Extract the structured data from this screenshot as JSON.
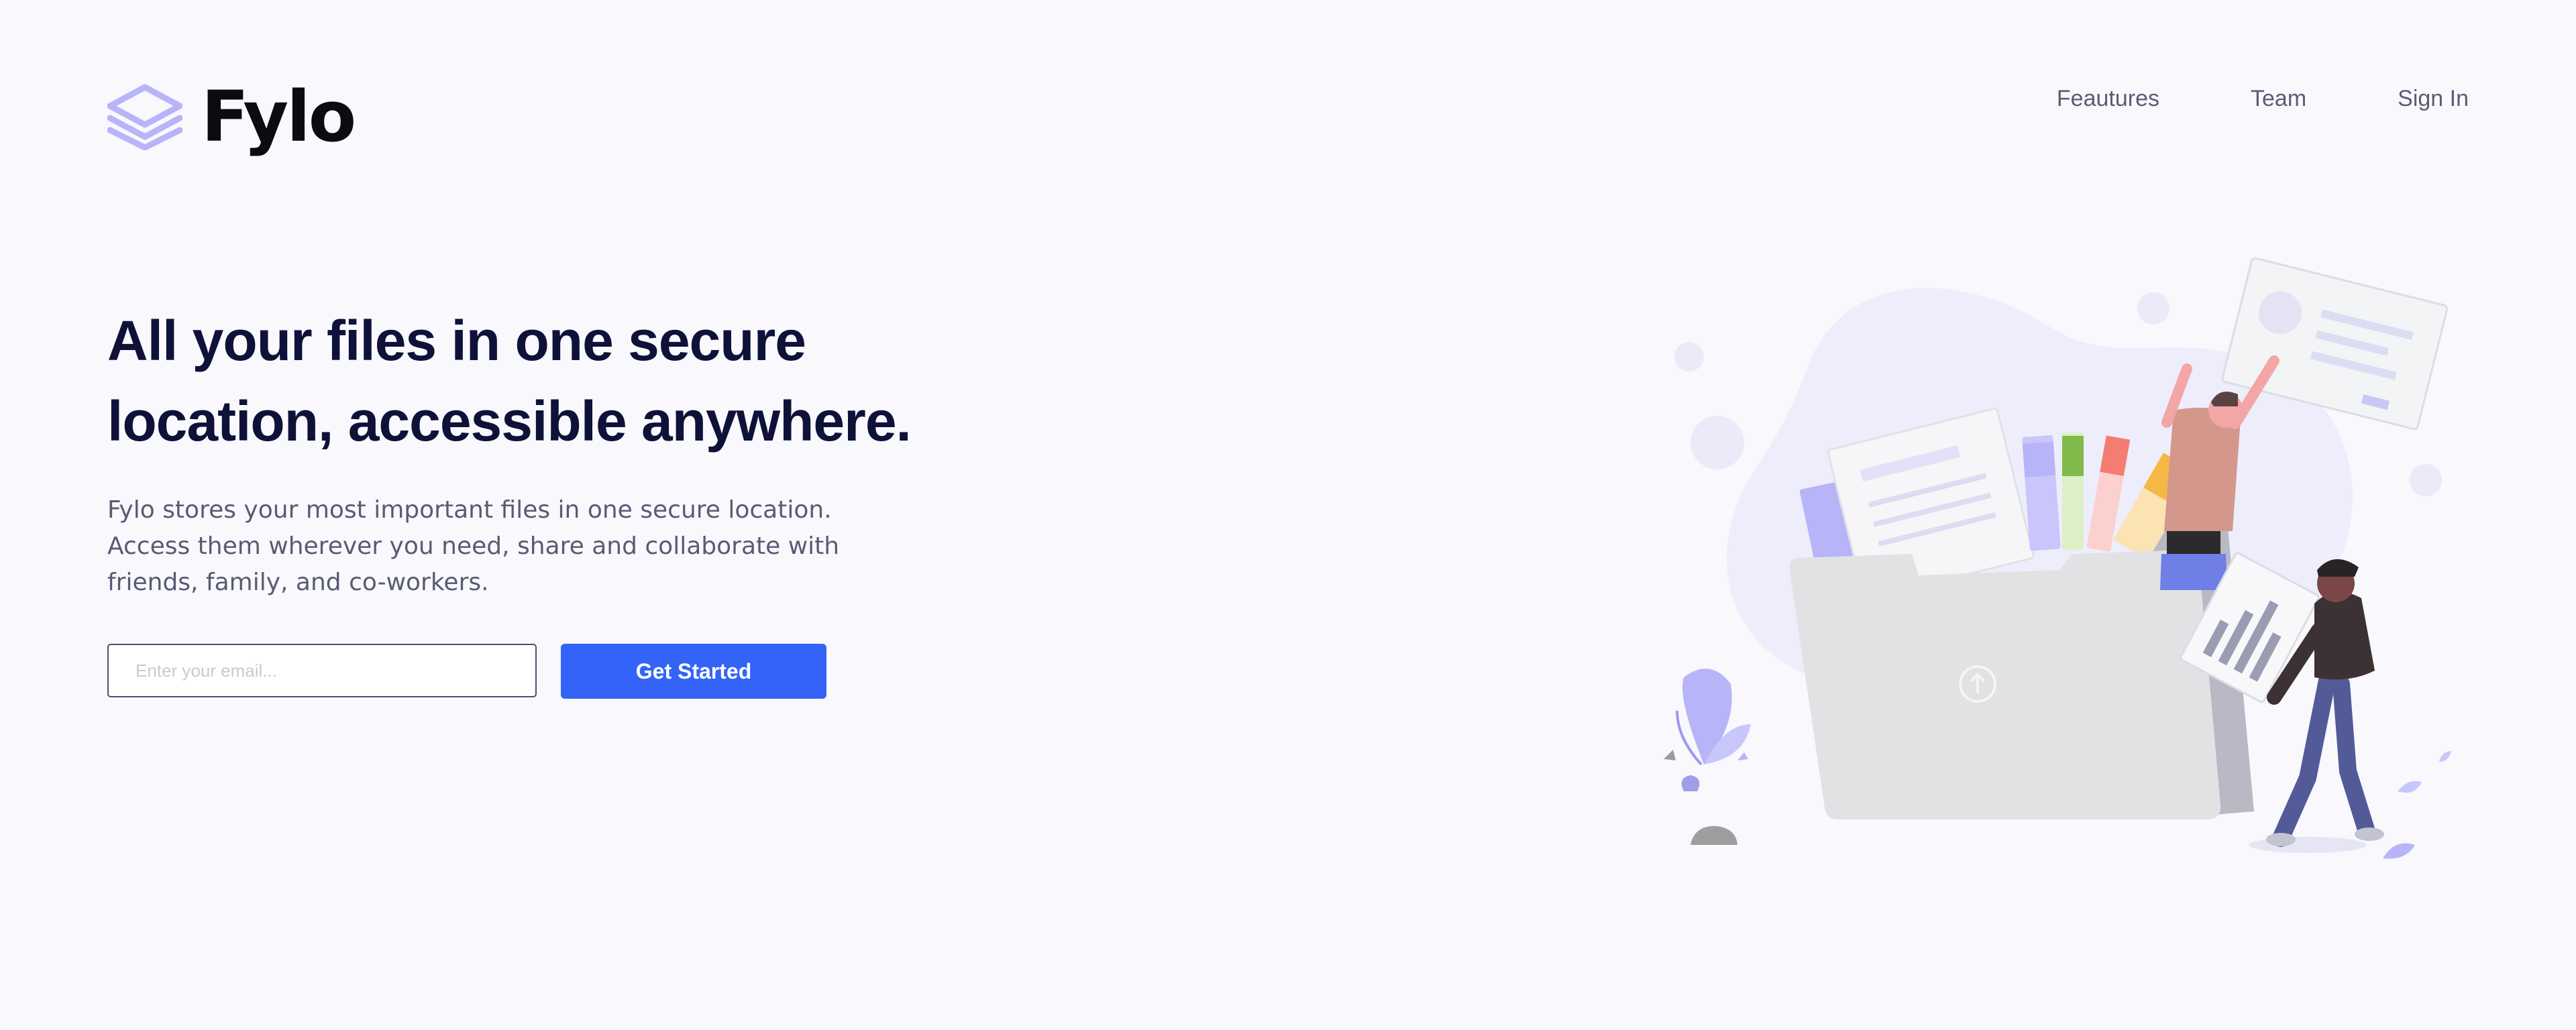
{
  "brand": {
    "name": "Fylo",
    "logo_icon": "stacked-layers-icon",
    "logo_color": "#b7b4f8"
  },
  "nav": {
    "items": [
      "Feautures",
      "Team",
      "Sign In"
    ]
  },
  "hero": {
    "headline": "All your files in one secure location, accessible anywhere.",
    "description": "Fylo stores your most important files in one secure location. Access them wherever you need, share and collaborate with friends, family, and co-workers.",
    "email_placeholder": "Enter your email...",
    "email_value": "",
    "cta_label": "Get Started"
  },
  "illustration": {
    "name": "people-uploading-files-illustration",
    "icons": [
      "upload-arrow-icon"
    ]
  },
  "colors": {
    "background": "#f8f8fd",
    "heading": "#0e1138",
    "body_text": "#585b73",
    "accent": "#3364f7",
    "illustration_lavender": "#b7b4f8"
  }
}
